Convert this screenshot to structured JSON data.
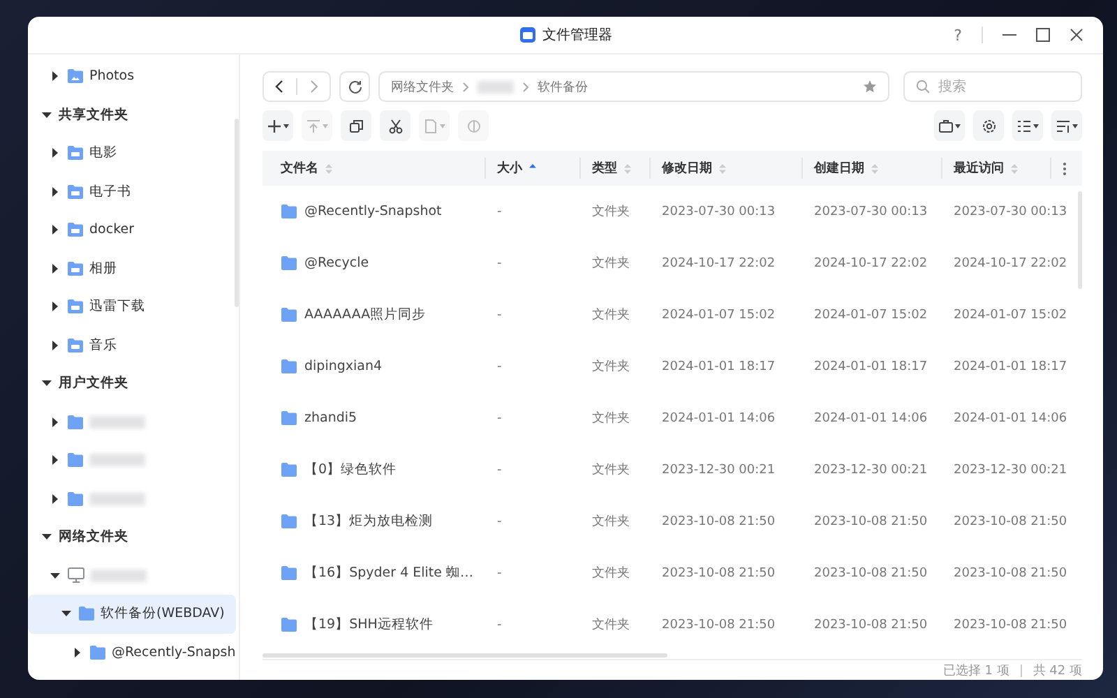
{
  "window": {
    "title": "文件管理器",
    "help": "?"
  },
  "sidebar": {
    "items": [
      {
        "kind": "section",
        "children": [
          {
            "kind": "photo-folder",
            "label": "Photos",
            "expanded": false
          }
        ]
      },
      {
        "kind": "section",
        "label": "共享文件夹",
        "expanded": true,
        "children": [
          {
            "kind": "shared-folder",
            "label": "电影",
            "expanded": false
          },
          {
            "kind": "shared-folder",
            "label": "电子书",
            "expanded": false
          },
          {
            "kind": "shared-folder",
            "label": "docker",
            "expanded": false
          },
          {
            "kind": "shared-folder",
            "label": "相册",
            "expanded": false
          },
          {
            "kind": "shared-folder",
            "label": "迅雷下载",
            "expanded": false
          },
          {
            "kind": "shared-folder",
            "label": "音乐",
            "expanded": false
          }
        ]
      },
      {
        "kind": "section",
        "label": "用户文件夹",
        "expanded": true,
        "children": [
          {
            "kind": "folder",
            "blurred": true,
            "expanded": false
          },
          {
            "kind": "folder",
            "blurred": true,
            "expanded": false
          },
          {
            "kind": "folder",
            "blurred": true,
            "expanded": false
          }
        ]
      },
      {
        "kind": "section",
        "label": "网络文件夹",
        "expanded": true,
        "children": [
          {
            "kind": "computer",
            "blurred": true,
            "expanded": true,
            "children": [
              {
                "kind": "folder",
                "label": "软件备份(WEBDAV)",
                "expanded": true,
                "selected": true,
                "children": [
                  {
                    "kind": "folder",
                    "label": "@Recently-Snapsh",
                    "expanded": false,
                    "selected": false
                  }
                ]
              }
            ]
          }
        ]
      }
    ]
  },
  "breadcrumb": [
    {
      "label": "网络文件夹"
    },
    {
      "blurred": true
    },
    {
      "label": "软件备份"
    }
  ],
  "search": {
    "placeholder": "搜索"
  },
  "toolbar": {
    "left": [
      {
        "disabled": false,
        "dropdown": true
      },
      {
        "disabled": true,
        "dropdown": true
      },
      {
        "disabled": false,
        "dropdown": false
      },
      {
        "disabled": false,
        "dropdown": false
      },
      {
        "disabled": true,
        "dropdown": true
      },
      {
        "disabled": true,
        "dropdown": false
      }
    ],
    "right": [
      {
        "disabled": false,
        "dropdown": true
      },
      {
        "disabled": false,
        "dropdown": false
      },
      {
        "disabled": false,
        "dropdown": true
      },
      {
        "disabled": false,
        "dropdown": true
      }
    ]
  },
  "table": {
    "columns": [
      {
        "label": "文件名",
        "sorted": false
      },
      {
        "label": "大小",
        "sorted": true
      },
      {
        "label": "类型",
        "sorted": false
      },
      {
        "label": "修改日期",
        "sorted": false
      },
      {
        "label": "创建日期",
        "sorted": false
      },
      {
        "label": "最近访问",
        "sorted": false
      }
    ],
    "rows": [
      [
        "@Recently-Snapshot",
        "-",
        "文件夹",
        "2023-07-30 00:13",
        "2023-07-30 00:13",
        "2023-07-30 00:13"
      ],
      [
        "@Recycle",
        "-",
        "文件夹",
        "2024-10-17 22:02",
        "2024-10-17 22:02",
        "2024-10-17 22:02"
      ],
      [
        "AAAAAAA照片同步",
        "-",
        "文件夹",
        "2024-01-07 15:02",
        "2024-01-07 15:02",
        "2024-01-07 15:02"
      ],
      [
        "dipingxian4",
        "-",
        "文件夹",
        "2024-01-01 18:17",
        "2024-01-01 18:17",
        "2024-01-01 18:17"
      ],
      [
        "zhandi5",
        "-",
        "文件夹",
        "2024-01-01 14:06",
        "2024-01-01 14:06",
        "2024-01-01 14:06"
      ],
      [
        "【0】绿色软件",
        "-",
        "文件夹",
        "2023-12-30 00:21",
        "2023-12-30 00:21",
        "2023-12-30 00:21"
      ],
      [
        "【13】炬为放电检测",
        "-",
        "文件夹",
        "2023-10-08 21:50",
        "2023-10-08 21:50",
        "2023-10-08 21:50"
      ],
      [
        "【16】Spyder 4 Elite 蜘…",
        "-",
        "文件夹",
        "2023-10-08 21:50",
        "2023-10-08 21:50",
        "2023-10-08 21:50"
      ],
      [
        "【19】SHH远程软件",
        "-",
        "文件夹",
        "2023-10-08 21:50",
        "2023-10-08 21:50",
        "2023-10-08 21:50"
      ]
    ]
  },
  "status_bar": {
    "selected": "已选择 1 项",
    "total": "共 42 项"
  }
}
